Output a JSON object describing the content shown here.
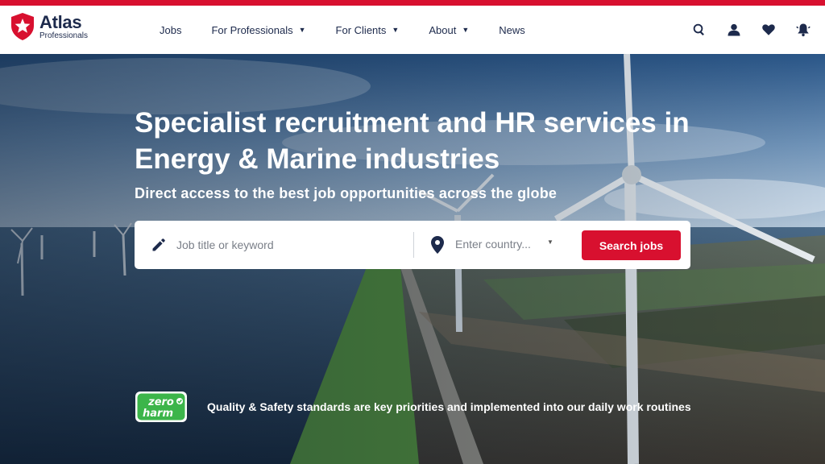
{
  "brand": {
    "name": "Atlas",
    "sub": "Professionals",
    "accent": "#d8102f",
    "navy": "#1d2a4c"
  },
  "nav": [
    {
      "label": "Jobs",
      "caret": ""
    },
    {
      "label": "For Professionals",
      "caret": "▼"
    },
    {
      "label": "For Clients",
      "caret": "▼"
    },
    {
      "label": "About",
      "caret": "▼"
    },
    {
      "label": "News",
      "caret": ""
    }
  ],
  "header_icons": [
    "search-icon",
    "user-icon",
    "heart-icon",
    "bell-icon"
  ],
  "hero": {
    "title": "Specialist recruitment and HR services in Energy & Marine industries",
    "subtitle": "Direct access to the best job opportunities across the globe"
  },
  "search": {
    "keyword_placeholder": "Job title or keyword",
    "country_placeholder": "Enter country...",
    "button": "Search jobs"
  },
  "badge": {
    "line1": "zero",
    "line2": "harm",
    "color": "#3cb54a"
  },
  "quality_text": "Quality & Safety standards are key priorities and implemented into our daily work routines"
}
